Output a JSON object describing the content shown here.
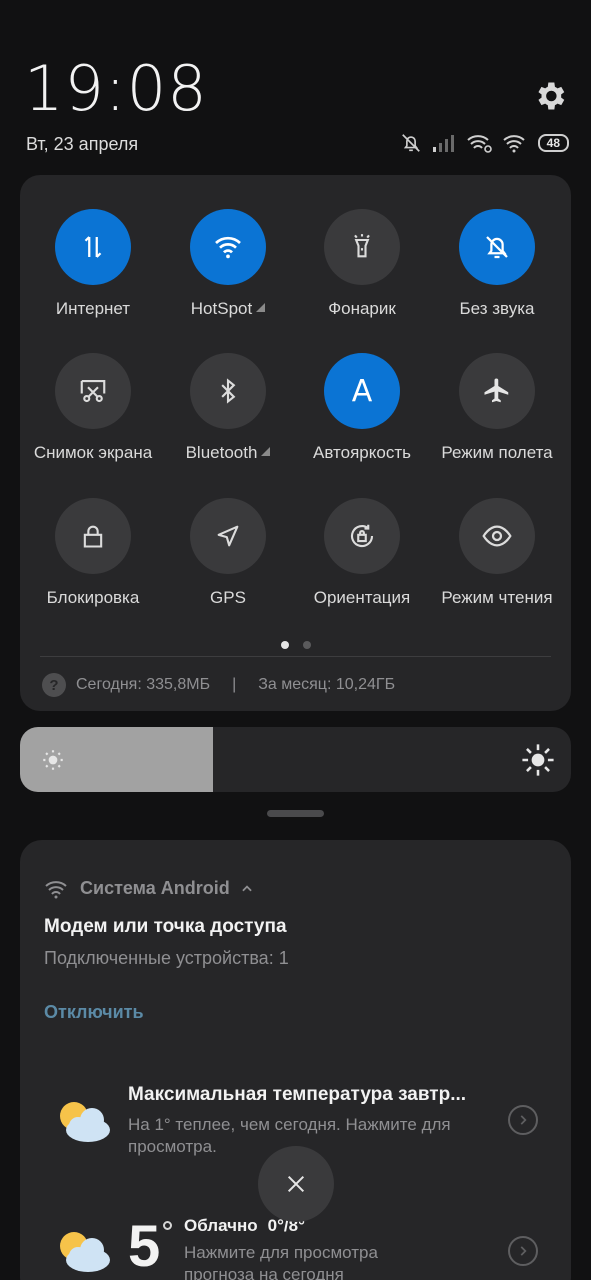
{
  "status": {
    "time": "19:08",
    "date": "Вт, 23 апреля",
    "battery": "48",
    "icons": [
      "bell-off-icon",
      "signal-icon",
      "wifi-hotspot-icon",
      "wifi-icon",
      "battery-icon"
    ]
  },
  "quick_settings": {
    "tiles": [
      {
        "label": "Интернет",
        "icon": "data-arrows-icon",
        "on": true
      },
      {
        "label": "HotSpot",
        "icon": "wifi-icon",
        "on": true,
        "has_menu": true
      },
      {
        "label": "Фонарик",
        "icon": "flashlight-icon",
        "on": false
      },
      {
        "label": "Без звука",
        "icon": "bell-off-icon",
        "on": true
      },
      {
        "label": "Снимок экрана",
        "icon": "screenshot-icon",
        "on": false
      },
      {
        "label": "Bluetooth",
        "icon": "bluetooth-icon",
        "on": false,
        "has_menu": true
      },
      {
        "label": "Автояркость",
        "icon": "auto-brightness-icon",
        "on": true,
        "glyph": "A"
      },
      {
        "label": "Режим полета",
        "icon": "airplane-icon",
        "on": false
      },
      {
        "label": "Блокировка",
        "icon": "lock-icon",
        "on": false
      },
      {
        "label": "GPS",
        "icon": "gps-icon",
        "on": false
      },
      {
        "label": "Ориентация",
        "icon": "rotation-icon",
        "on": false
      },
      {
        "label": "Режим чтения",
        "icon": "eye-icon",
        "on": false
      }
    ],
    "pages": {
      "current": 1,
      "total": 2
    },
    "data_usage": {
      "today": "Сегодня: 335,8МБ",
      "separator": "|",
      "month": "За месяц: 10,24ГБ"
    }
  },
  "brightness": {
    "level_fraction": 0.35
  },
  "notifications": {
    "android": {
      "app": "Система Android",
      "title": "Модем или точка доступа",
      "text": "Подключенные устройства: 1",
      "action": "Отключить"
    },
    "weather1": {
      "title": "Максимальная температура завтр...",
      "text": "На 1° теплее, чем сегодня. Нажмите для просмотра."
    },
    "weather2": {
      "temp": "5",
      "condition": "Облачно",
      "range": "0°/8°",
      "text": "Нажмите для просмотра прогноза на сегодня"
    }
  },
  "colors": {
    "accent": "#0b74d4",
    "panel": "#262628",
    "action": "#5b8aa6"
  }
}
